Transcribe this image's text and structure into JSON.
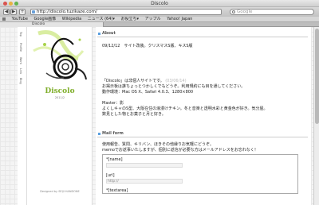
{
  "window": {
    "title": "Discolo"
  },
  "toolbar": {
    "back": "◀",
    "forward": "▶",
    "address": "http://discolo.tuzikaze.com/",
    "search_placeholder": "Google"
  },
  "bookmarks": [
    "YouTube",
    "Google画像",
    "Wikipedia",
    "ニュース (64)▾",
    "お役立ち▾",
    "アップル",
    "Yahoo! Japan"
  ],
  "tab": {
    "label": "Discolo"
  },
  "leftnav": [
    "Top",
    "Profile",
    "Work",
    "Link",
    "Blog"
  ],
  "banner": {
    "logo": "Discolo",
    "subtitle": "2011/2",
    "credit": "Designed by SEIJI HANDONE"
  },
  "about": {
    "heading": "About",
    "date_line": "09/12/12　サイト改装。クリスマスS版、キスS版",
    "intro": "「Discolo」は非個人サイトです。",
    "intro_note": "(03/06/14)",
    "line1": "お掲示板は誰ちょっとつかしくでもどうぞ。利用規約にも目を通してください。",
    "line2": "動作環境：Mac OS X、Safari 4.0.3、1280×800",
    "master_label": "Master：影",
    "master1": "よくしキャのS型、大阪在住の浪漫けチキン。冬と音楽と透明水彩と黄金色が好き。気分屋。",
    "master2": "数見とした物とお菓子と月と好き。"
  },
  "mailform": {
    "heading": "Mail form",
    "line1": "使用報告、質問、キリバン、ほきその他縁りお気軽にどうぞ。",
    "line2": "memoでお返事いたしますが、個別に返信が必要な方はメールアドレスをお忘れなく！",
    "name_label": "*[name]",
    "url_label": "[url]",
    "url_placeholder": "http://",
    "textarea_label": "*[textarea]"
  },
  "colors": {
    "accent": "#5aa0e0",
    "logo": "#7fae2a"
  }
}
